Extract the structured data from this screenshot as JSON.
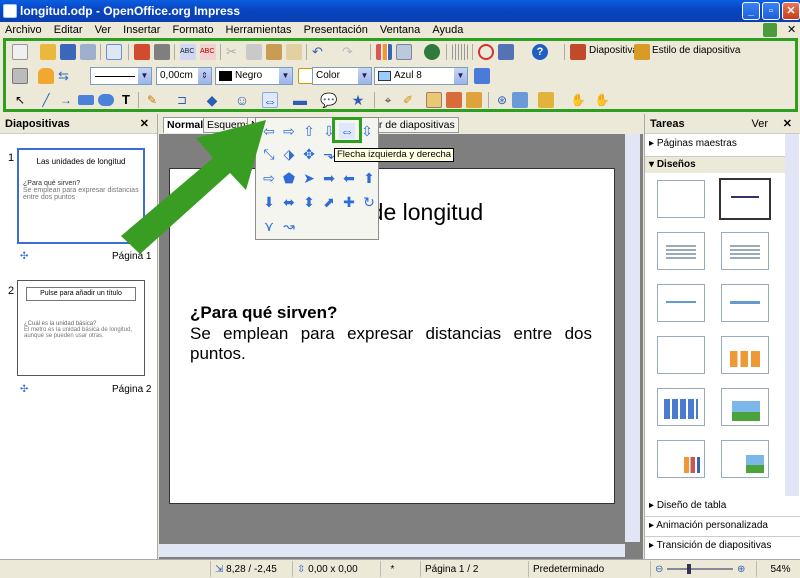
{
  "window": {
    "title": "longitud.odp - OpenOffice.org Impress"
  },
  "menu": [
    "Archivo",
    "Editar",
    "Ver",
    "Insertar",
    "Formato",
    "Herramientas",
    "Presentación",
    "Ventana",
    "Ayuda"
  ],
  "toolbar": {
    "diapositiva_label": "Diapositiva",
    "estilo_label": "Estilo de diapositiva",
    "line_width": "0,00cm",
    "line_color": "Negro",
    "area_style": "Color",
    "area_color": "Azul 8"
  },
  "slides_panel": {
    "title": "Diapositivas",
    "slides": [
      {
        "number": "1",
        "title": "Las unidades de longitud",
        "body_q": "¿Para qué sirven?",
        "body_t": "Se emplean para expresar distancias entre dos puntos",
        "label": "Página 1"
      },
      {
        "number": "2",
        "title": "Pulse para añadir un título",
        "body_q": "¿Cuál es la unidad básica?",
        "body_t": "El metro es la unidad básica de longitud, aunque se pueden usar otras.",
        "label": "Página 2"
      }
    ]
  },
  "tabs": [
    "Normal",
    "Esquema",
    "N",
    "or de diapositivas"
  ],
  "slide": {
    "title_partial": "es de longitud",
    "heading": "¿Para qué sirven?",
    "body": "Se emplean para expresar distancias entre dos puntos."
  },
  "popup": {
    "tooltip": "Flecha izquierda y derecha"
  },
  "tasks": {
    "title": "Tareas",
    "view_label": "Ver",
    "master_pages": "Páginas maestras",
    "layouts": "Diseños",
    "table_design": "Diseño de tabla",
    "custom_animation": "Animación personalizada",
    "slide_transition": "Transición de diapositivas"
  },
  "status": {
    "position": "8,28 / -2,45",
    "size": "0,00 x 0,00",
    "modified": "*",
    "page": "Página 1 / 2",
    "style": "Predeterminado",
    "zoom": "54%"
  }
}
